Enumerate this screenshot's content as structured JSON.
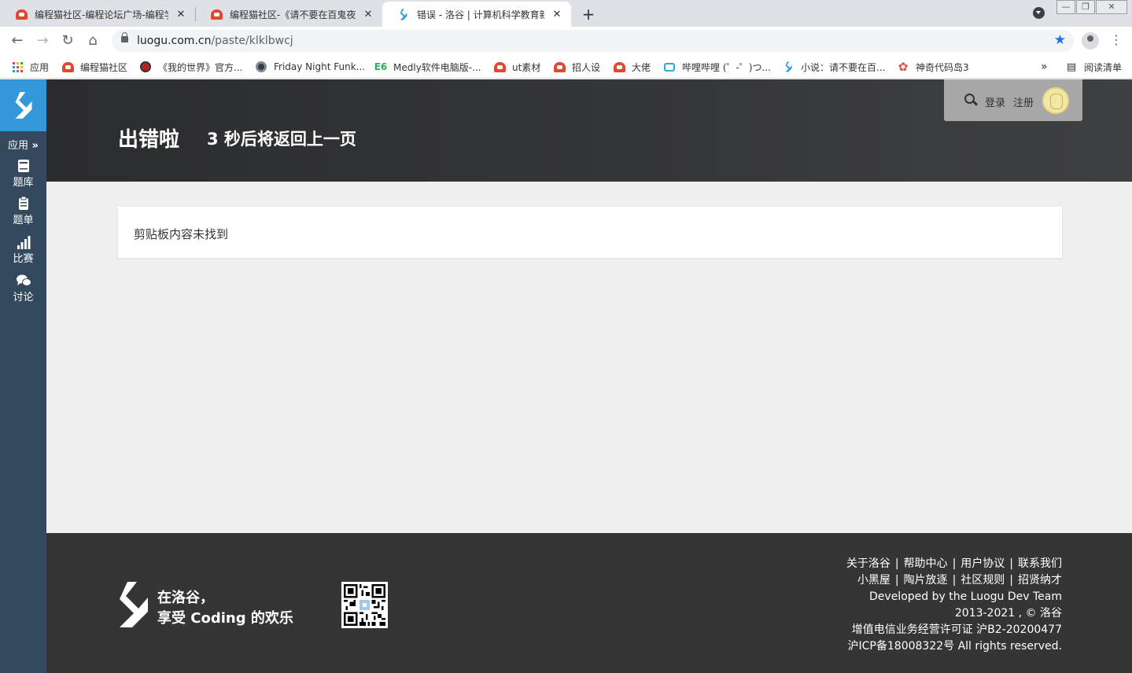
{
  "browser": {
    "tabs": [
      {
        "title": "编程猫社区-编程论坛广场-编程学习",
        "icon": "codemao-icon",
        "active": false
      },
      {
        "title": "编程猫社区-《请不要在百鬼夜行",
        "icon": "codemao-icon",
        "active": false
      },
      {
        "title": "错误 - 洛谷 | 计算机科学教育新生态",
        "icon": "luogu-icon",
        "active": true
      }
    ],
    "new_tab": "+",
    "url_host": "luogu.com.cn",
    "url_path": "/paste/klklbwcj",
    "bookmarks": [
      {
        "label": "应用",
        "icon": "apps-grid-icon"
      },
      {
        "label": "编程猫社区",
        "icon": "codemao-icon"
      },
      {
        "label": "《我的世界》官方...",
        "icon": "minecraft-icon"
      },
      {
        "label": "Friday Night Funk...",
        "icon": "fnf-icon"
      },
      {
        "label": "Medly软件电脑版-...",
        "icon": "medly-icon"
      },
      {
        "label": "ut素材",
        "icon": "codemao-icon"
      },
      {
        "label": "招人设",
        "icon": "codemao-icon"
      },
      {
        "label": "大佬",
        "icon": "codemao-icon"
      },
      {
        "label": "哔哩哔哩 (゜-゜)つ...",
        "icon": "bilibili-icon"
      },
      {
        "label": "小说：请不要在百...",
        "icon": "luogu-icon"
      },
      {
        "label": "神奇代码岛3",
        "icon": "codeisland-icon"
      }
    ],
    "more_bookmarks": "»",
    "reading_list": "阅读清单"
  },
  "sidebar": {
    "apps_label": "应用",
    "items": [
      {
        "label": "题库",
        "icon": "book-icon"
      },
      {
        "label": "题单",
        "icon": "clipboard-icon"
      },
      {
        "label": "比赛",
        "icon": "bar-chart-icon"
      },
      {
        "label": "讨论",
        "icon": "chat-bubbles-icon"
      }
    ]
  },
  "header": {
    "title": "出错啦",
    "countdown": "3 秒后将返回上一页",
    "login": "登录",
    "register": "注册"
  },
  "main": {
    "message": "剪贴板内容未找到"
  },
  "footer": {
    "slogan_line1": "在洛谷，",
    "slogan_line2": "享受 Coding 的欢乐",
    "links_row1": [
      "关于洛谷",
      "帮助中心",
      "用户协议",
      "联系我们"
    ],
    "links_row2": [
      "小黑屋",
      "陶片放逐",
      "社区规则",
      "招贤纳才"
    ],
    "dev_prefix": "Developed by the ",
    "dev_team": "Luogu Dev Team",
    "copyright": "2013-2021 , © 洛谷",
    "license": "增值电信业务经营许可证 沪B2-20200477",
    "icp": "沪ICP备18008322号 All rights reserved."
  },
  "colors": {
    "sidebar": "#34495e",
    "logo_bg": "#3498db",
    "header_bg": "#2b2c2e",
    "footer_bg": "#353535",
    "page_bg": "#efefef",
    "bookmark_star": "#1a73e8"
  }
}
